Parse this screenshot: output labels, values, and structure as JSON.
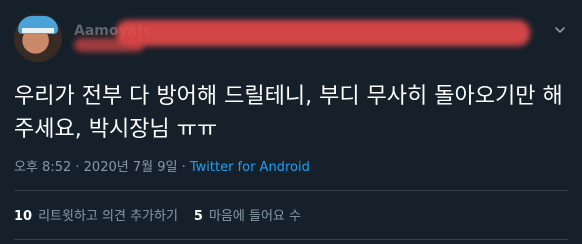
{
  "tweet": {
    "author": {
      "display_name": "Aamoya(c"
    },
    "text": "우리가 전부 다 방어해 드릴테니, 부디 무사히 돌아오기만 해 주세요, 박시장님 ㅠㅠ",
    "meta": {
      "time": "오후 8:52",
      "separator1": " · ",
      "date": "2020년 7월 9일",
      "separator2": " · ",
      "source": "Twitter for Android"
    },
    "stats": {
      "retweets_count": "10",
      "retweets_label": "리트윗하고 의견 추가하기",
      "likes_count": "5",
      "likes_label": "마음에 들어요 수"
    },
    "colors": {
      "background": "#15202b",
      "text": "#ffffff",
      "muted": "#8899a6",
      "link": "#1da1f2",
      "divider": "#38444d",
      "redaction": "#e74a4a"
    },
    "icons": {
      "more": "chevron-down-icon"
    }
  }
}
